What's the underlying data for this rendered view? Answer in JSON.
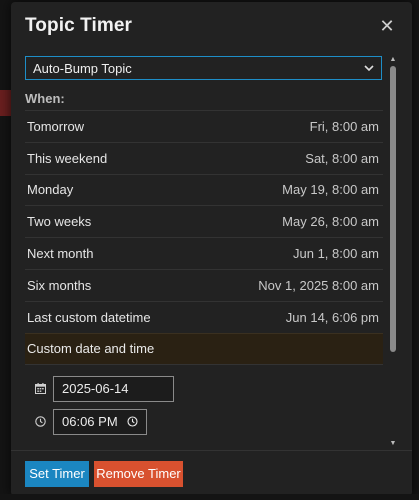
{
  "modal": {
    "title": "Topic Timer",
    "close_symbol": "✕"
  },
  "timer_type": {
    "selected": "Auto-Bump Topic"
  },
  "when_label": "When:",
  "options": [
    {
      "label": "Tomorrow",
      "value": "Fri, 8:00 am"
    },
    {
      "label": "This weekend",
      "value": "Sat, 8:00 am"
    },
    {
      "label": "Monday",
      "value": "May 19, 8:00 am"
    },
    {
      "label": "Two weeks",
      "value": "May 26, 8:00 am"
    },
    {
      "label": "Next month",
      "value": "Jun 1, 8:00 am"
    },
    {
      "label": "Six months",
      "value": "Nov 1, 2025 8:00 am"
    },
    {
      "label": "Last custom datetime",
      "value": "Jun 14, 6:06 pm"
    }
  ],
  "custom": {
    "label": "Custom date and time",
    "date_value": "2025-06-14",
    "time_value": "06:06 PM"
  },
  "footer": {
    "set_label": "Set Timer",
    "remove_label": "Remove Timer"
  },
  "colors": {
    "accent": "#1b86c1",
    "danger": "#d8512f",
    "selected_row": "#2a2113"
  },
  "icons": [
    "close-icon",
    "chevron-down-icon",
    "calendar-icon",
    "clock-icon"
  ]
}
